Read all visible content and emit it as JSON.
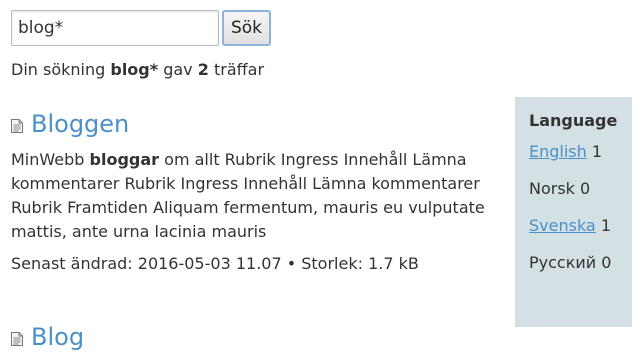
{
  "search": {
    "value": "blog*",
    "button_label": "Sök"
  },
  "summary": {
    "prefix": "Din sökning",
    "query": "blog*",
    "middle": "gav",
    "count": "2",
    "suffix": "träffar"
  },
  "results": [
    {
      "title": "Bloggen",
      "snippet_prefix": "MinWebb",
      "snippet_highlight": "bloggar",
      "snippet_rest": "om allt Rubrik Ingress Innehåll Lämna kommentarer Rubrik Ingress Innehåll Lämna kommentarer Rubrik Framtiden Aliquam fermentum, mauris eu vulputate mattis, ante urna lacinia mauris",
      "meta": "Senast ändrad: 2016-05-03 11.07 • Storlek: 1.7 kB"
    },
    {
      "title": "Blog"
    }
  ],
  "language_panel": {
    "heading": "Language",
    "items": [
      {
        "label": "English",
        "count": "1",
        "link": true
      },
      {
        "label": "Norsk",
        "count": "0",
        "link": false
      },
      {
        "label": "Svenska",
        "count": "1",
        "link": true
      },
      {
        "label": "Русский",
        "count": "0",
        "link": false
      }
    ]
  },
  "colors": {
    "link": "#4a90c9",
    "panel_bg": "#d3e1e5",
    "button_border": "#8cb2de"
  }
}
